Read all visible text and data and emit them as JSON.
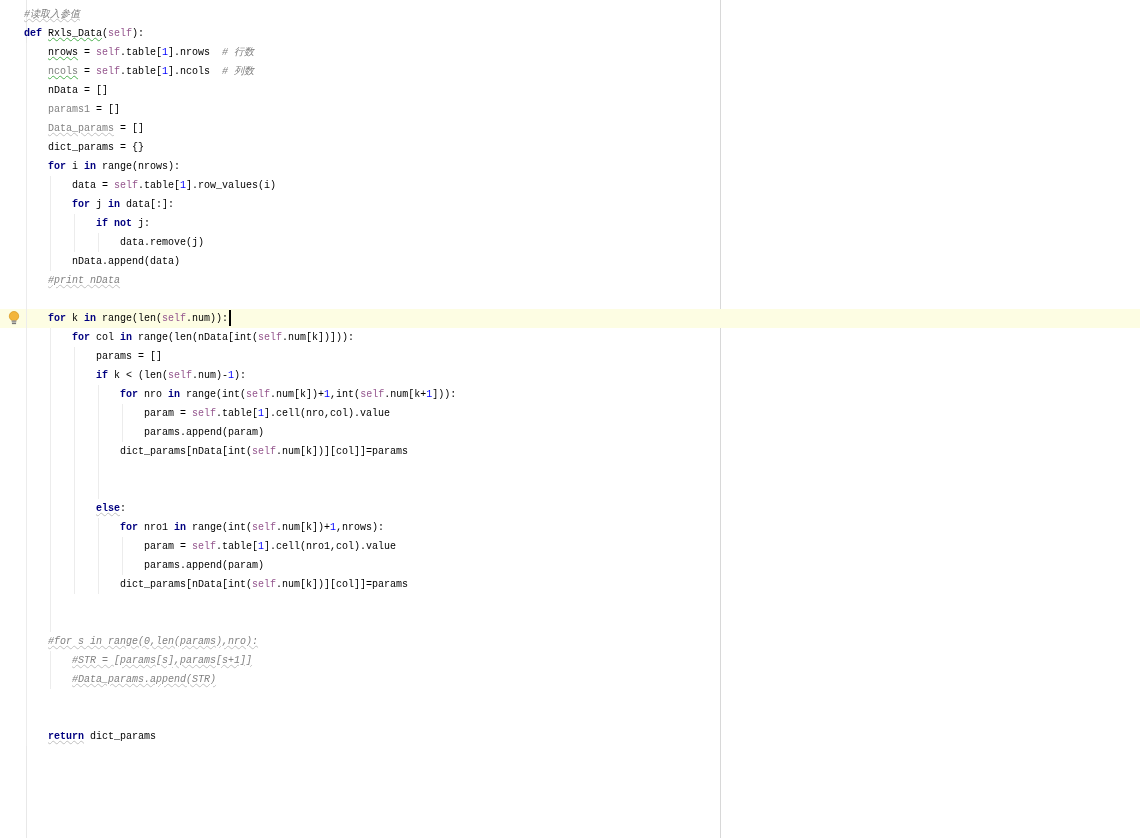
{
  "editor": {
    "lines": [
      {
        "kind": "code",
        "tokens": [
          {
            "kind": "comment",
            "text": "#读取入参值",
            "warning": true
          }
        ]
      },
      {
        "kind": "code",
        "tokens": [
          {
            "kind": "kw",
            "text": "def "
          },
          {
            "kind": "plain",
            "text": "Rxls_Data",
            "typo": true
          },
          {
            "kind": "plain",
            "text": "("
          },
          {
            "kind": "self",
            "text": "self"
          },
          {
            "kind": "plain",
            "text": "):"
          }
        ],
        "children": [
          {
            "kind": "code",
            "tokens": [
              {
                "kind": "plain",
                "text": "nrows",
                "typo": true
              },
              {
                "kind": "plain",
                "text": " = "
              },
              {
                "kind": "self",
                "text": "self"
              },
              {
                "kind": "plain",
                "text": ".table["
              },
              {
                "kind": "num",
                "text": "1"
              },
              {
                "kind": "plain",
                "text": "].nrows  "
              },
              {
                "kind": "comment",
                "text": "# 行数"
              }
            ]
          },
          {
            "kind": "code",
            "tokens": [
              {
                "kind": "weak",
                "text": "ncols",
                "typo": true
              },
              {
                "kind": "plain",
                "text": " = "
              },
              {
                "kind": "self",
                "text": "self"
              },
              {
                "kind": "plain",
                "text": ".table["
              },
              {
                "kind": "num",
                "text": "1"
              },
              {
                "kind": "plain",
                "text": "].ncols  "
              },
              {
                "kind": "comment",
                "text": "# 列数"
              }
            ]
          },
          {
            "kind": "code",
            "tokens": [
              {
                "kind": "plain",
                "text": "nData = []"
              }
            ]
          },
          {
            "kind": "code",
            "tokens": [
              {
                "kind": "weak",
                "text": "params1"
              },
              {
                "kind": "plain",
                "text": " = []"
              }
            ]
          },
          {
            "kind": "code",
            "tokens": [
              {
                "kind": "weak",
                "text": "Data_params",
                "warning": true
              },
              {
                "kind": "plain",
                "text": " = []"
              }
            ]
          },
          {
            "kind": "code",
            "tokens": [
              {
                "kind": "plain",
                "text": "dict_params = {}"
              }
            ]
          },
          {
            "kind": "code",
            "tokens": [
              {
                "kind": "kw",
                "text": "for"
              },
              {
                "kind": "plain",
                "text": " i "
              },
              {
                "kind": "kw",
                "text": "in"
              },
              {
                "kind": "plain",
                "text": " range(nrows):"
              }
            ],
            "children": [
              {
                "kind": "code",
                "tokens": [
                  {
                    "kind": "plain",
                    "text": "data = "
                  },
                  {
                    "kind": "self",
                    "text": "self"
                  },
                  {
                    "kind": "plain",
                    "text": ".table["
                  },
                  {
                    "kind": "num",
                    "text": "1"
                  },
                  {
                    "kind": "plain",
                    "text": "].row_values(i)"
                  }
                ]
              },
              {
                "kind": "code",
                "tokens": [
                  {
                    "kind": "kw",
                    "text": "for"
                  },
                  {
                    "kind": "plain",
                    "text": " j "
                  },
                  {
                    "kind": "kw",
                    "text": "in"
                  },
                  {
                    "kind": "plain",
                    "text": " data[:]:"
                  }
                ],
                "children": [
                  {
                    "kind": "code",
                    "tokens": [
                      {
                        "kind": "kw",
                        "text": "if not"
                      },
                      {
                        "kind": "plain",
                        "text": " j:"
                      }
                    ],
                    "children": [
                      {
                        "kind": "code",
                        "tokens": [
                          {
                            "kind": "plain",
                            "text": "data.remove(j)"
                          }
                        ]
                      }
                    ]
                  }
                ]
              },
              {
                "kind": "code",
                "tokens": [
                  {
                    "kind": "plain",
                    "text": "nData.append(data)"
                  }
                ]
              }
            ]
          },
          {
            "kind": "code",
            "tokens": [
              {
                "kind": "comment",
                "text": "#print nData",
                "warning": true
              }
            ]
          },
          {
            "kind": "blank"
          },
          {
            "kind": "code",
            "current": true,
            "caret": true,
            "bulb": true,
            "tokens": [
              {
                "kind": "kw",
                "text": "for"
              },
              {
                "kind": "plain",
                "text": " k "
              },
              {
                "kind": "kw",
                "text": "in"
              },
              {
                "kind": "plain",
                "text": " range(len("
              },
              {
                "kind": "self",
                "text": "self"
              },
              {
                "kind": "plain",
                "text": ".num)):"
              }
            ],
            "children": [
              {
                "kind": "code",
                "tokens": [
                  {
                    "kind": "kw",
                    "text": "for"
                  },
                  {
                    "kind": "plain",
                    "text": " col "
                  },
                  {
                    "kind": "kw",
                    "text": "in"
                  },
                  {
                    "kind": "plain",
                    "text": " range(len(nData[int("
                  },
                  {
                    "kind": "self",
                    "text": "self"
                  },
                  {
                    "kind": "plain",
                    "text": ".num[k])])):"
                  }
                ],
                "children": [
                  {
                    "kind": "code",
                    "tokens": [
                      {
                        "kind": "plain",
                        "text": "params = []"
                      }
                    ]
                  },
                  {
                    "kind": "code",
                    "tokens": [
                      {
                        "kind": "kw",
                        "text": "if"
                      },
                      {
                        "kind": "plain",
                        "text": " k < (len("
                      },
                      {
                        "kind": "self",
                        "text": "self"
                      },
                      {
                        "kind": "plain",
                        "text": ".num)-"
                      },
                      {
                        "kind": "num",
                        "text": "1"
                      },
                      {
                        "kind": "plain",
                        "text": "):"
                      }
                    ],
                    "children": [
                      {
                        "kind": "code",
                        "tokens": [
                          {
                            "kind": "kw",
                            "text": "for"
                          },
                          {
                            "kind": "plain",
                            "text": " nro "
                          },
                          {
                            "kind": "kw",
                            "text": "in"
                          },
                          {
                            "kind": "plain",
                            "text": " range(int("
                          },
                          {
                            "kind": "self",
                            "text": "self"
                          },
                          {
                            "kind": "plain",
                            "text": ".num[k])+"
                          },
                          {
                            "kind": "num",
                            "text": "1"
                          },
                          {
                            "kind": "plain",
                            "text": ",int("
                          },
                          {
                            "kind": "self",
                            "text": "self"
                          },
                          {
                            "kind": "plain",
                            "text": ".num[k+"
                          },
                          {
                            "kind": "num",
                            "text": "1"
                          },
                          {
                            "kind": "plain",
                            "text": "])):"
                          }
                        ],
                        "children": [
                          {
                            "kind": "code",
                            "tokens": [
                              {
                                "kind": "plain",
                                "text": "param = "
                              },
                              {
                                "kind": "self",
                                "text": "self"
                              },
                              {
                                "kind": "plain",
                                "text": ".table["
                              },
                              {
                                "kind": "num",
                                "text": "1"
                              },
                              {
                                "kind": "plain",
                                "text": "].cell(nro,col).value"
                              }
                            ]
                          },
                          {
                            "kind": "code",
                            "tokens": [
                              {
                                "kind": "plain",
                                "text": "params.append(param)"
                              }
                            ]
                          }
                        ]
                      },
                      {
                        "kind": "code",
                        "tokens": [
                          {
                            "kind": "plain",
                            "text": "dict_params[nData[int("
                          },
                          {
                            "kind": "self",
                            "text": "self"
                          },
                          {
                            "kind": "plain",
                            "text": ".num[k])][col]]=params"
                          }
                        ]
                      },
                      {
                        "kind": "blank"
                      },
                      {
                        "kind": "blank"
                      }
                    ]
                  },
                  {
                    "kind": "code",
                    "tokens": [
                      {
                        "kind": "kw",
                        "text": "else",
                        "warning": true
                      },
                      {
                        "kind": "plain",
                        "text": ":"
                      }
                    ],
                    "children": [
                      {
                        "kind": "code",
                        "tokens": [
                          {
                            "kind": "kw",
                            "text": "for"
                          },
                          {
                            "kind": "plain",
                            "text": " nro1 "
                          },
                          {
                            "kind": "kw",
                            "text": "in"
                          },
                          {
                            "kind": "plain",
                            "text": " range(int("
                          },
                          {
                            "kind": "self",
                            "text": "self"
                          },
                          {
                            "kind": "plain",
                            "text": ".num[k])+"
                          },
                          {
                            "kind": "num",
                            "text": "1"
                          },
                          {
                            "kind": "plain",
                            "text": ",nrows):"
                          }
                        ],
                        "children": [
                          {
                            "kind": "code",
                            "tokens": [
                              {
                                "kind": "plain",
                                "text": "param = "
                              },
                              {
                                "kind": "self",
                                "text": "self"
                              },
                              {
                                "kind": "plain",
                                "text": ".table["
                              },
                              {
                                "kind": "num",
                                "text": "1"
                              },
                              {
                                "kind": "plain",
                                "text": "].cell(nro1,col).value"
                              }
                            ]
                          },
                          {
                            "kind": "code",
                            "tokens": [
                              {
                                "kind": "plain",
                                "text": "params.append(param)"
                              }
                            ]
                          }
                        ]
                      },
                      {
                        "kind": "code",
                        "tokens": [
                          {
                            "kind": "plain",
                            "text": "dict_params[nData[int("
                          },
                          {
                            "kind": "self",
                            "text": "self"
                          },
                          {
                            "kind": "plain",
                            "text": ".num[k])][col]]=params"
                          }
                        ]
                      }
                    ]
                  }
                ]
              },
              {
                "kind": "blank"
              },
              {
                "kind": "blank"
              }
            ]
          },
          {
            "kind": "code",
            "tokens": [
              {
                "kind": "comment",
                "text": "#for s in range(0,len(params),nro):",
                "warning": true
              }
            ],
            "children": [
              {
                "kind": "code",
                "tokens": [
                  {
                    "kind": "comment",
                    "text": "#STR = [params[s],params[s+1]]",
                    "warning": true
                  }
                ]
              },
              {
                "kind": "code",
                "tokens": [
                  {
                    "kind": "comment",
                    "text": "#Data_params.append(STR)",
                    "warning": true
                  }
                ]
              }
            ]
          },
          {
            "kind": "blank"
          },
          {
            "kind": "blank"
          },
          {
            "kind": "code",
            "tokens": [
              {
                "kind": "kw",
                "text": "return",
                "warning": true
              },
              {
                "kind": "plain",
                "text": " dict_params"
              }
            ]
          }
        ]
      }
    ]
  }
}
